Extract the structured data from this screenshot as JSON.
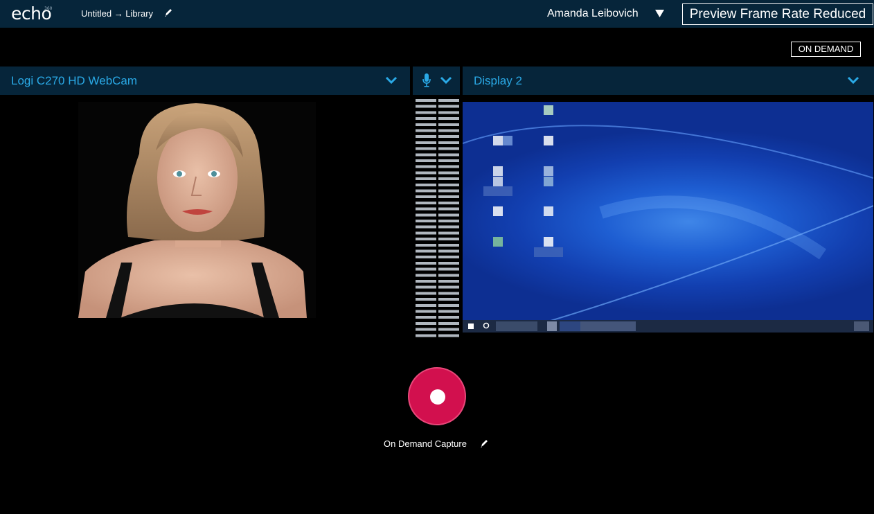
{
  "header": {
    "logo_text": "echo",
    "logo_super": "360",
    "breadcrumb": "Untitled → Library",
    "edit_icon": "pencil-icon",
    "user_name": "Amanda Leibovich",
    "user_menu_icon": "caret-down-icon",
    "preview_button": "Preview Frame Rate Reduced"
  },
  "mode_badge": "ON DEMAND",
  "sources": {
    "camera": {
      "label": "Logi C270 HD WebCam",
      "icon": "chevron-down-icon"
    },
    "audio": {
      "icon": "microphone-icon",
      "chevron": "chevron-down-icon"
    },
    "display": {
      "label": "Display 2",
      "icon": "chevron-down-icon"
    }
  },
  "capture": {
    "record_icon": "record-icon",
    "label": "On Demand Capture",
    "edit_icon": "pencil-icon"
  },
  "colors": {
    "header_bg": "#06253a",
    "accent": "#2aa9e6",
    "record": "#d2104e"
  }
}
